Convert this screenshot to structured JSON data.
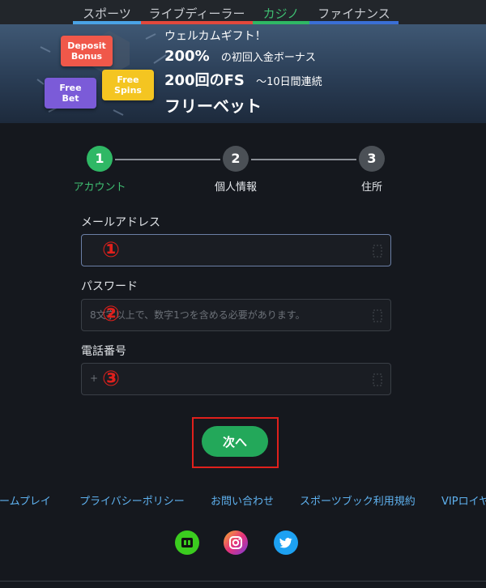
{
  "nav": {
    "tabs": [
      {
        "label": "スポーツ",
        "color": "#4aa3e6"
      },
      {
        "label": "ライブディーラー",
        "color": "#e2483c"
      },
      {
        "label": "カジノ",
        "color": "#2fb865"
      },
      {
        "label": "ファイナンス",
        "color": "#3a6fd6"
      }
    ]
  },
  "banner": {
    "badges": {
      "deposit": "Deposit Bonus",
      "free_bet": "Free Bet",
      "free_spins": "Free Spins"
    },
    "welcome": "ウェルカムギフト！",
    "line1_main": "200%",
    "line1_sub": "の初回入金ボーナス",
    "line2_main": "200回のFS",
    "line2_sub": "〜10日間連続",
    "line3": "フリーベット"
  },
  "stepper": {
    "steps": [
      {
        "number": "1",
        "label": "アカウント",
        "active": true
      },
      {
        "number": "2",
        "label": "個人情報",
        "active": false
      },
      {
        "number": "3",
        "label": "住所",
        "active": false
      }
    ]
  },
  "form": {
    "email": {
      "label": "メールアドレス",
      "value": "",
      "placeholder": "",
      "marker": "①"
    },
    "password": {
      "label": "パスワード",
      "value": "",
      "placeholder": "8文字以上で、数字1つを含める必要があります。",
      "marker": "②"
    },
    "phone": {
      "label": "電話番号",
      "prefix": "+",
      "value": "",
      "placeholder": "",
      "marker": "③"
    }
  },
  "next_button": {
    "label": "次へ"
  },
  "footer": {
    "links": [
      "ゲームプレイ",
      "プライバシーポリシー",
      "お問い合わせ",
      "スポーツブック利用規約",
      "VIPロイヤ"
    ]
  },
  "social": [
    "sportsbook-icon",
    "instagram-icon",
    "twitter-icon"
  ],
  "colors": {
    "accent": "#2fb865",
    "annotation": "#e0201c",
    "link": "#5fb2f0"
  }
}
